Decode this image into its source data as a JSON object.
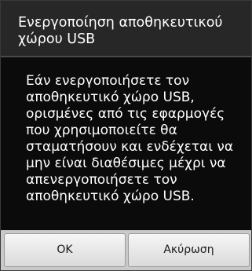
{
  "dialog": {
    "title": "Ενεργοποίηση αποθηκευτικού χώρου USB",
    "message": "Εάν ενεργοποιήσετε τον αποθηκευτικό χώρο USB, ορισμένες από τις εφαρμογές που χρησιμοποιείτε θα σταματήσουν και ενδέχεται να μην είναι διαθέσιμες μέχρι να απενεργοποιήσετε τον αποθηκευτικό χώρο USB.",
    "buttons": {
      "ok": "OK",
      "cancel": "Ακύρωση"
    }
  }
}
